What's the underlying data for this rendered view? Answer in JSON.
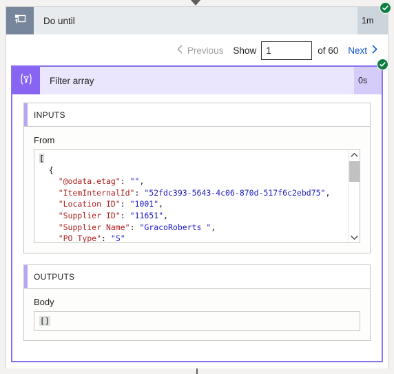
{
  "do_until": {
    "icon": "do-until-loop-icon",
    "title": "Do until",
    "duration": "1m",
    "status": "succeeded",
    "status_color": "#107c41"
  },
  "pagination": {
    "previous_label": "Previous",
    "previous_enabled": false,
    "show_label": "Show",
    "page_value": "1",
    "page_placeholder": "",
    "of_label": "of 60",
    "total_pages": 60,
    "next_label": "Next",
    "next_enabled": true,
    "next_color": "#0b53ce",
    "disabled_color": "#a19f9d"
  },
  "filter_array": {
    "icon": "filter-funnel-icon",
    "title": "Filter array",
    "duration": "0s",
    "status": "succeeded",
    "accent_color": "#8764f2",
    "border_color": "#8a70f0"
  },
  "inputs": {
    "section_title": "INPUTS",
    "field_label": "From",
    "code_lines": [
      "[",
      "  {",
      "    \"@odata.etag\": \"\",",
      "    \"ItemInternalId\": \"52fdc393-5643-4c06-870d-517f6c2ebd75\",",
      "    \"Location ID\": \"1001\",",
      "    \"Supplier ID\": \"11651\",",
      "    \"Supplier Name\": \"GracoRoberts \",",
      "    \"PO Type\": \"S\""
    ],
    "scroll_up_icon": "chevron-up-icon",
    "scroll_down_icon": "chevron-down-icon"
  },
  "outputs": {
    "section_title": "OUTPUTS",
    "field_label": "Body",
    "body_value": "[]"
  }
}
